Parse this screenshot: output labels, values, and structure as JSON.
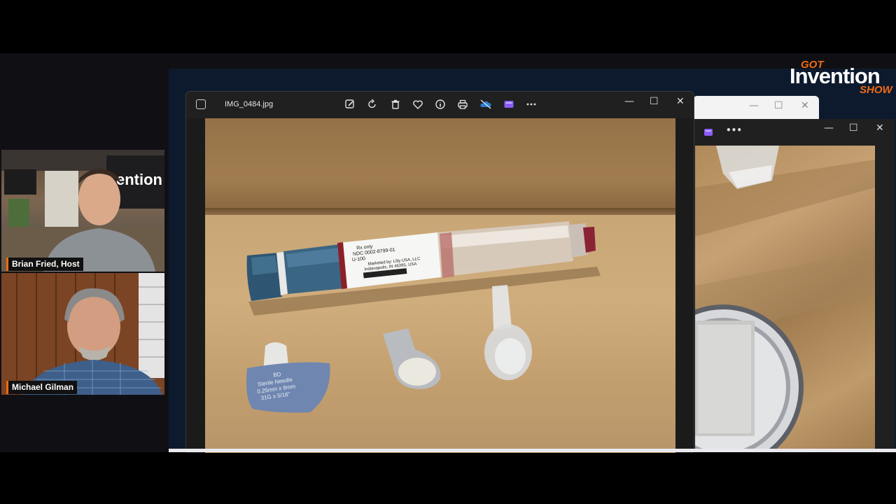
{
  "logo": {
    "got": "GOT",
    "invention": "Invention",
    "show": "SHOW"
  },
  "photos_window": {
    "file_name": "IMG_0484.jpg",
    "toolbar_icons": [
      "edit-icon",
      "rotate-icon",
      "delete-icon",
      "favorite-icon",
      "info-icon",
      "print-icon",
      "onedrive-icon",
      "clipchamp-icon",
      "more-icon"
    ],
    "minimize": "—",
    "maximize": "☐",
    "close": "✕"
  },
  "back_window": {
    "minimize": "—",
    "maximize": "☐",
    "close": "✕"
  },
  "second_window": {
    "more": "•••",
    "minimize": "—",
    "maximize": "☐",
    "close": "✕"
  },
  "participants": [
    {
      "name": "Brian Fried, Host"
    },
    {
      "name": "Michael Gilman"
    }
  ],
  "photo_labels": {
    "pen_line1": "Rx only",
    "pen_line2": "NDC 0002-8799-01",
    "pen_line3": "U-100",
    "pen_line4": "Marketed by: Lilly USA, LLC",
    "pen_line5": "Indianapolis, IN 46285, USA",
    "needle_line1": "BD",
    "needle_line2": "Sterile Needle",
    "needle_line3": "0.25mm x 8mm",
    "needle_line4": "31G x 5/16\""
  },
  "colors": {
    "accent": "#f06a14",
    "window_bg": "#202020",
    "pen_blue": "#3a6583"
  }
}
